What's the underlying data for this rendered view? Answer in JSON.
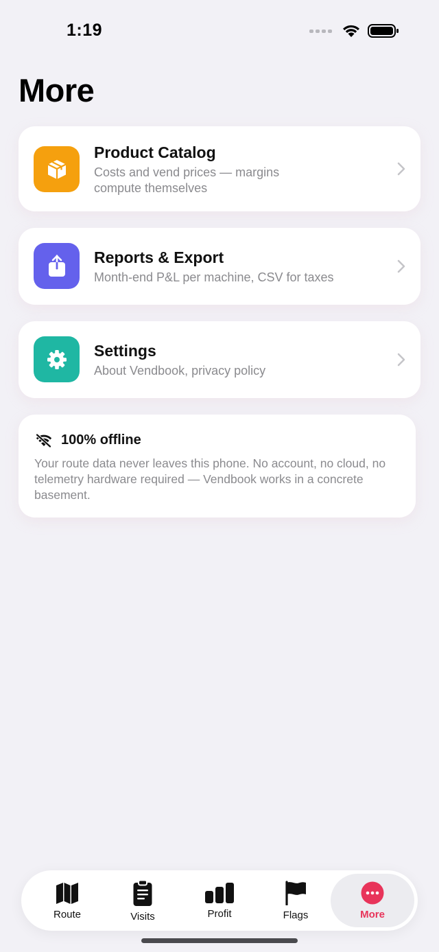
{
  "status_bar": {
    "time": "1:19"
  },
  "page": {
    "title": "More"
  },
  "menu": [
    {
      "title": "Product Catalog",
      "subtitle": "Costs and vend prices — margins compute themselves",
      "icon": "box-icon",
      "color": "#F5A00E"
    },
    {
      "title": "Reports & Export",
      "subtitle": "Month-end P&L per machine, CSV for taxes",
      "icon": "share-icon",
      "color": "#6461EC"
    },
    {
      "title": "Settings",
      "subtitle": "About Vendbook, privacy policy",
      "icon": "gear-icon",
      "color": "#1FB7A3"
    }
  ],
  "offline": {
    "title": "100% offline",
    "body": "Your route data never leaves this phone. No account, no cloud, no telemetry hardware required — Vendbook works in a concrete basement."
  },
  "tabs": [
    {
      "label": "Route",
      "icon": "map-icon"
    },
    {
      "label": "Visits",
      "icon": "clipboard-icon"
    },
    {
      "label": "Profit",
      "icon": "bar-chart-icon"
    },
    {
      "label": "Flags",
      "icon": "flag-icon"
    },
    {
      "label": "More",
      "icon": "more-icon",
      "active": true
    }
  ],
  "colors": {
    "accent": "#E8345A",
    "background": "#F2F1F6"
  }
}
